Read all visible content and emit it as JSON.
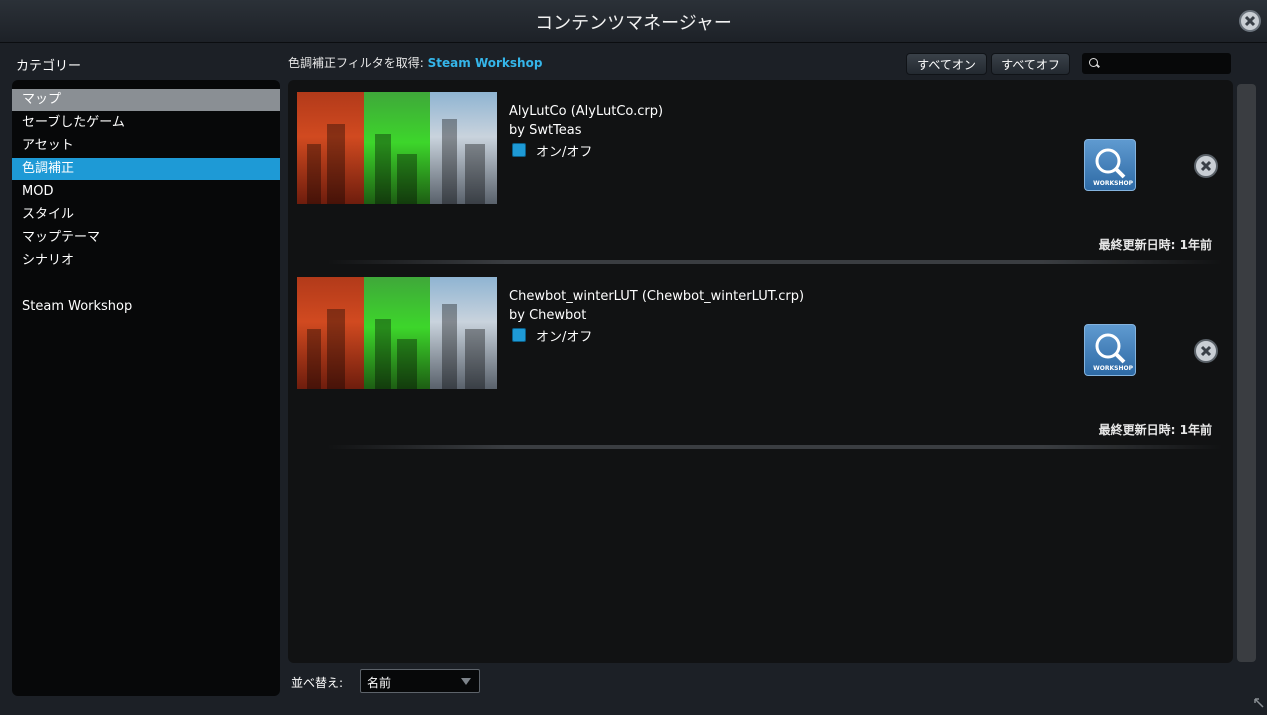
{
  "window": {
    "title": "コンテンツマネージャー"
  },
  "sidebar": {
    "label": "カテゴリー",
    "items": [
      {
        "label": "マップ"
      },
      {
        "label": "セーブしたゲーム"
      },
      {
        "label": "アセット"
      },
      {
        "label": "色調補正"
      },
      {
        "label": "MOD"
      },
      {
        "label": "スタイル"
      },
      {
        "label": "マップテーマ"
      },
      {
        "label": "シナリオ"
      },
      {
        "label": "Steam Workshop"
      }
    ]
  },
  "header": {
    "filter_label": "色調補正フィルタを取得:",
    "filter_link": "Steam Workshop",
    "all_on": "すべてオン",
    "all_off": "すべてオフ",
    "search_value": ""
  },
  "items": [
    {
      "name": "AlyLutCo (AlyLutCo.crp)",
      "author": "by SwtTeas",
      "toggle_label": "オン/オフ",
      "enabled": true,
      "updated": "最終更新日時: 1年前"
    },
    {
      "name": "Chewbot_winterLUT (Chewbot_winterLUT.crp)",
      "author": "by Chewbot",
      "toggle_label": "オン/オフ",
      "enabled": true,
      "updated": "最終更新日時: 1年前"
    }
  ],
  "footer": {
    "sort_label": "並べ替え:",
    "sort_value": "名前"
  },
  "colors": {
    "accent": "#1e9ad6",
    "link": "#35b6ea",
    "panel": "#111213"
  }
}
